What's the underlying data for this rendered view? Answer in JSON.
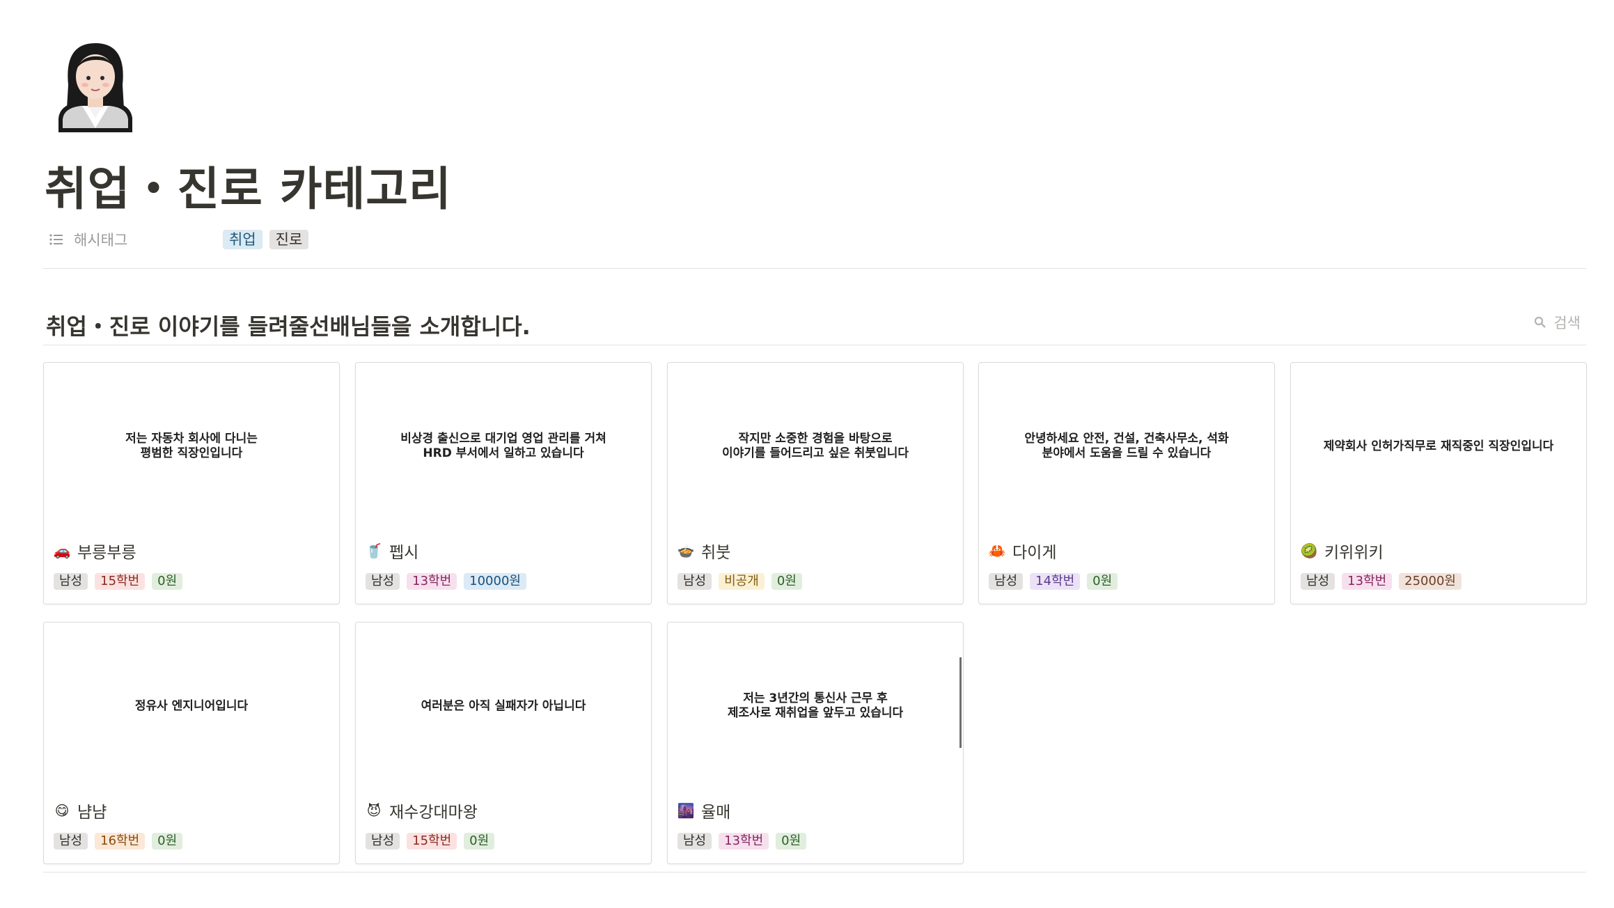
{
  "page": {
    "icon": "businesswoman-emoji-icon",
    "title": "취업・진로 카테고리",
    "property": {
      "name": "해시태그",
      "icon": "list-icon",
      "tags": [
        {
          "label": "취업",
          "color": "blue"
        },
        {
          "label": "진로",
          "color": "gray"
        }
      ]
    }
  },
  "gallery": {
    "heading": "취업・진로 이야기를 들려줄선배님들을 소개합니다.",
    "search_label": "검색",
    "cards": [
      {
        "cover": [
          "저는 자동차 회사에 다니는",
          "평범한 직장인입니다"
        ],
        "emoji": "🚗",
        "title": "부릉부릉",
        "gender": "남성",
        "year": "15학번",
        "year_color": "red",
        "price": "0원",
        "price_color": "green"
      },
      {
        "cover": [
          "비상경 출신으로 대기업 영업 관리를 거쳐",
          "HRD 부서에서 일하고 있습니다"
        ],
        "emoji": "🥤",
        "title": "펩시",
        "gender": "남성",
        "year": "13학번",
        "year_color": "pink",
        "price": "10000원",
        "price_color": "lightblue"
      },
      {
        "cover": [
          "작지만 소중한 경험을 바탕으로",
          "이야기를 들어드리고 싶은 취붓입니다"
        ],
        "emoji": "🍲",
        "title": "취붓",
        "gender": "남성",
        "year": "비공개",
        "year_color": "yellow",
        "price": "0원",
        "price_color": "green"
      },
      {
        "cover": [
          "안녕하세요 안전, 건설, 건축사무소, 석화",
          "분야에서 도움을 드릴 수 있습니다"
        ],
        "emoji": "🦀",
        "title": "다이게",
        "gender": "남성",
        "year": "14학번",
        "year_color": "purple",
        "price": "0원",
        "price_color": "green"
      },
      {
        "cover": [
          "제약회사 인허가직무로 재직중인 직장인입니다"
        ],
        "emoji": "🥝",
        "title": "키위위키",
        "gender": "남성",
        "year": "13학번",
        "year_color": "pink",
        "price": "25000원",
        "price_color": "brown"
      },
      {
        "cover": [
          "정유사 엔지니어입니다"
        ],
        "emoji": "😋",
        "title": "냠냠",
        "gender": "남성",
        "year": "16학번",
        "year_color": "orange",
        "price": "0원",
        "price_color": "green"
      },
      {
        "cover": [
          "여러분은 아직 실패자가 아닙니다"
        ],
        "emoji": "😈",
        "title": "재수강대마왕",
        "gender": "남성",
        "year": "15학번",
        "year_color": "red",
        "price": "0원",
        "price_color": "green"
      },
      {
        "cover": [
          "저는 3년간의 통신사 근무 후",
          "제조사로 재취업을 앞두고 있습니다"
        ],
        "emoji": "🌆",
        "title": "율매",
        "gender": "남성",
        "year": "13학번",
        "year_color": "pink",
        "price": "0원",
        "price_color": "green"
      }
    ]
  }
}
